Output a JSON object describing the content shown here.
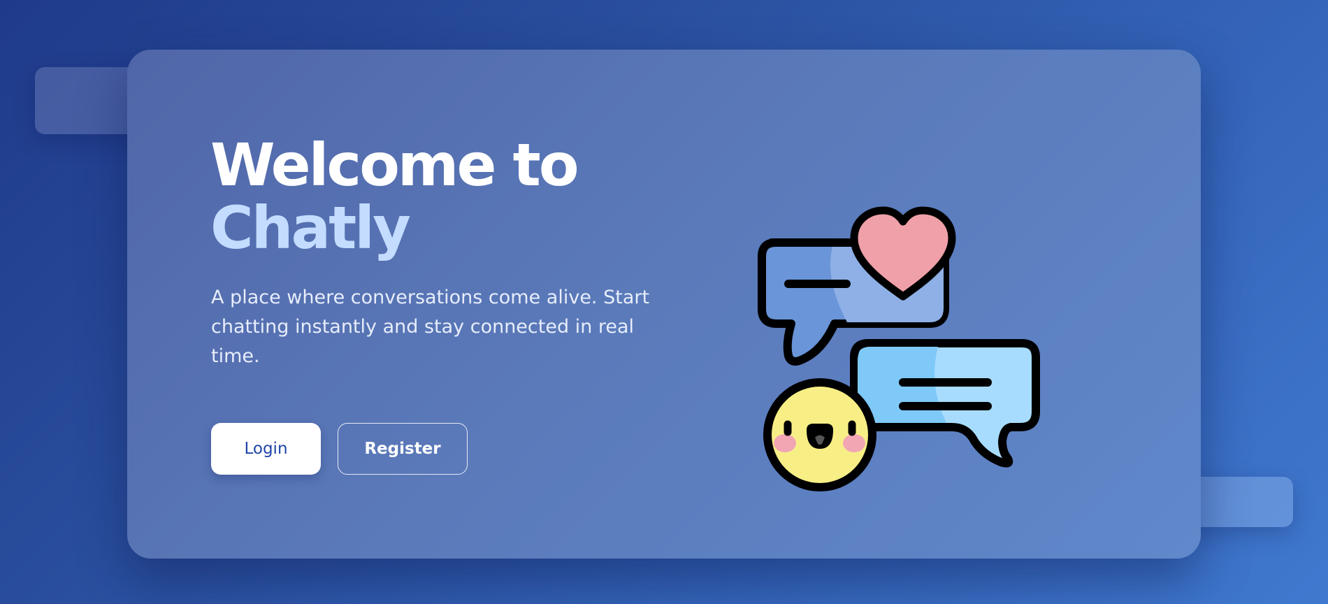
{
  "hero": {
    "title_line1": "Welcome to",
    "title_line2": "Chatly",
    "subtitle": "A place where conversations come alive. Start chatting instantly and stay connected in real time.",
    "login_label": "Login",
    "register_label": "Register"
  },
  "illustration": {
    "icon": "chat-bubbles-illustration",
    "elements": [
      "heart-icon",
      "smiley-face-icon"
    ]
  },
  "colors": {
    "background": "#2a4f9e",
    "card": "#5a79b9",
    "title": "#ffffff",
    "brand_accent": "#c3dcff",
    "login_text": "#2045a8",
    "bubble_blue": "#6a95d8",
    "bubble_light": "#a8dcff",
    "heart": "#efa0a8",
    "face": "#f7ef86"
  }
}
